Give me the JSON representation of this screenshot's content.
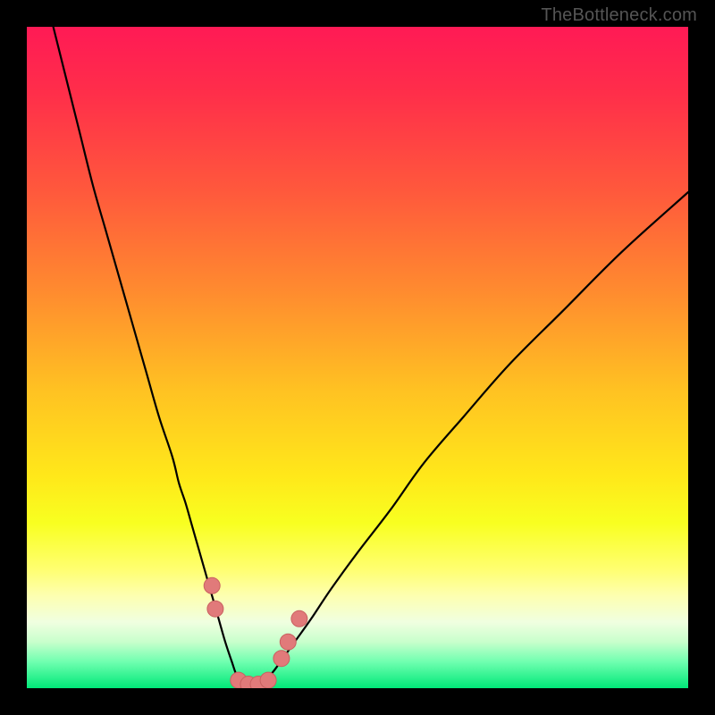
{
  "watermark": "TheBottleneck.com",
  "colors": {
    "frame": "#000000",
    "gradient_stops": [
      {
        "offset": 0.0,
        "color": "#ff1a55"
      },
      {
        "offset": 0.1,
        "color": "#ff2e4a"
      },
      {
        "offset": 0.25,
        "color": "#ff593c"
      },
      {
        "offset": 0.4,
        "color": "#ff8b2f"
      },
      {
        "offset": 0.55,
        "color": "#ffc222"
      },
      {
        "offset": 0.68,
        "color": "#ffe81a"
      },
      {
        "offset": 0.75,
        "color": "#f8ff20"
      },
      {
        "offset": 0.82,
        "color": "#ffff70"
      },
      {
        "offset": 0.86,
        "color": "#fdffb0"
      },
      {
        "offset": 0.9,
        "color": "#f0ffe0"
      },
      {
        "offset": 0.93,
        "color": "#c8ffcc"
      },
      {
        "offset": 0.96,
        "color": "#70ffb0"
      },
      {
        "offset": 1.0,
        "color": "#00e878"
      }
    ],
    "curve": "#000000",
    "marker_fill": "#e17a7a",
    "marker_stroke": "#c96060"
  },
  "chart_data": {
    "type": "line",
    "title": "",
    "xlabel": "",
    "ylabel": "",
    "xlim": [
      0,
      100
    ],
    "ylim": [
      0,
      100
    ],
    "note": "V-shaped bottleneck curve over gradient background. x ~ component balance ratio (0–100), y ~ bottleneck severity % (0 = ideal, 100 = severe). Values estimated from pixel positions.",
    "series": [
      {
        "name": "bottleneck-curve",
        "x": [
          4,
          6,
          8,
          10,
          12,
          14,
          16,
          18,
          20,
          22,
          23,
          24,
          25,
          26,
          27,
          28,
          29,
          30,
          31,
          31.7,
          32.5,
          33.5,
          34.5,
          35.5,
          37,
          38.5,
          40.5,
          43,
          46,
          50,
          55,
          60,
          66,
          73,
          81,
          90,
          100
        ],
        "y": [
          100,
          92,
          84,
          76,
          69,
          62,
          55,
          48,
          41,
          35,
          31,
          28,
          24.5,
          21,
          17.5,
          14,
          10.5,
          7,
          4,
          2,
          0.8,
          0.2,
          0.2,
          0.9,
          2.2,
          4.2,
          7,
          10.5,
          15,
          20.5,
          27,
          34,
          41,
          49,
          57,
          66,
          75
        ]
      }
    ],
    "markers": [
      {
        "x": 28.0,
        "y": 15.5
      },
      {
        "x": 28.5,
        "y": 12.0
      },
      {
        "x": 32.0,
        "y": 1.2
      },
      {
        "x": 33.5,
        "y": 0.6
      },
      {
        "x": 35.0,
        "y": 0.6
      },
      {
        "x": 36.5,
        "y": 1.2
      },
      {
        "x": 38.5,
        "y": 4.5
      },
      {
        "x": 39.5,
        "y": 7.0
      },
      {
        "x": 41.2,
        "y": 10.5
      }
    ]
  }
}
